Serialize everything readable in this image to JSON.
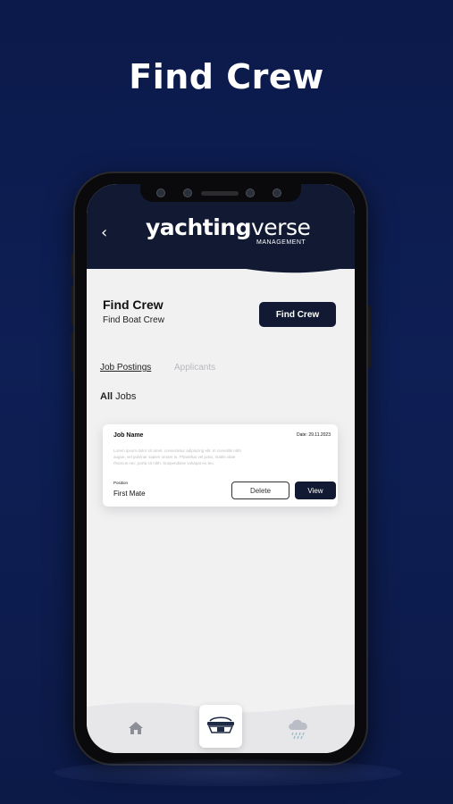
{
  "headline": "Find Crew",
  "header": {
    "back_icon": "chevron-left-icon",
    "logo_bold": "yachting",
    "logo_light": "verse",
    "logo_sub": "MANAGEMENT"
  },
  "page": {
    "title": "Find Crew",
    "subtitle": "Find Boat Crew",
    "find_button": "Find Crew"
  },
  "tabs": [
    {
      "label": "Job Postings",
      "active": true
    },
    {
      "label": "Applicants",
      "active": false
    }
  ],
  "list_heading": {
    "bold": "All",
    "rest": " Jobs"
  },
  "job_card": {
    "name": "Job Name",
    "date": "Date: 29.11.2023",
    "description": "Lorem ipsum dolor sit amet, consectetur adipiscing elit. In convallis nibh augue, vel pulvinar sapien ornare in. Phasellus vel justo, mattis vitae rhoncus nec, porta sit nibh. Suspendisse volutpat eu leo.",
    "position_label": "Position",
    "position_value": "First Mate",
    "delete_label": "Delete",
    "view_label": "View"
  },
  "bottom_nav": [
    {
      "icon": "home-icon"
    },
    {
      "icon": "boat-icon"
    },
    {
      "icon": "weather-rain-icon"
    }
  ],
  "colors": {
    "background": "#0d1d52",
    "primary_dark": "#121a33",
    "screen_bg": "#f1f1f2"
  }
}
